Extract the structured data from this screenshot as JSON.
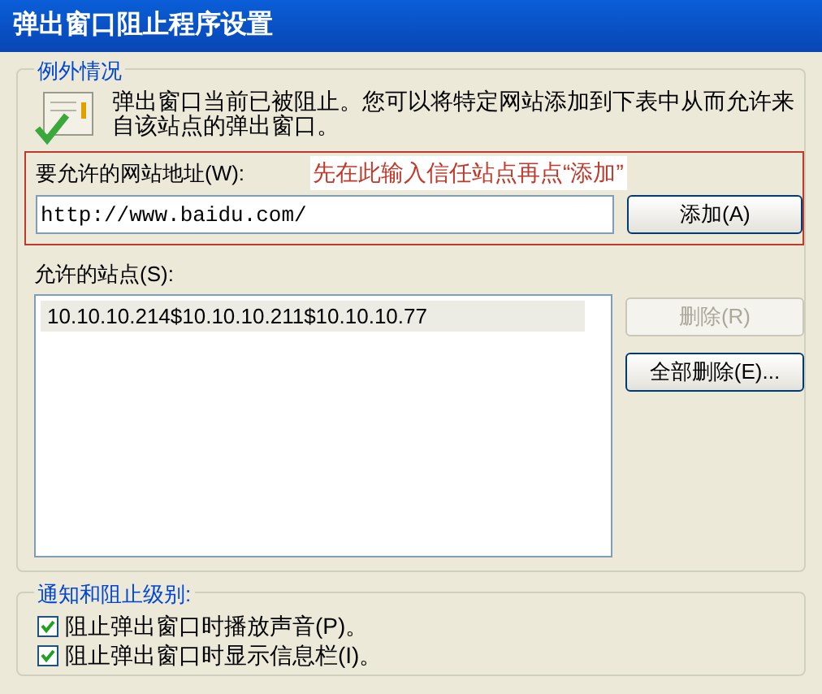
{
  "window": {
    "title": "弹出窗口阻止程序设置"
  },
  "exceptions": {
    "title": "例外情况",
    "message": "弹出窗口当前已被阻止。您可以将特定网站添加到下表中从而允许来自该站点的弹出窗口。",
    "annotation": "先在此输入信任站点再点“添加”",
    "address_label": "要允许的网站地址(W):",
    "address_value": "http://www.baidu.com/",
    "add_button": {
      "label": "添加(A)",
      "disabled": false
    },
    "sites_label": "允许的站点(S):",
    "sites": [
      {
        "text": "10.10.10.214$10.10.10.211$10.10.10.77",
        "selected": true
      }
    ],
    "remove_button": {
      "label": "删除(R)",
      "disabled": true
    },
    "remove_all_button": {
      "label": "全部删除(E)...",
      "disabled": false
    }
  },
  "notifications": {
    "title": "通知和阻止级别:",
    "options": [
      {
        "label": "阻止弹出窗口时播放声音(P)。",
        "checked": true
      },
      {
        "label": "阻止弹出窗口时显示信息栏(I)。",
        "checked": true
      }
    ]
  }
}
